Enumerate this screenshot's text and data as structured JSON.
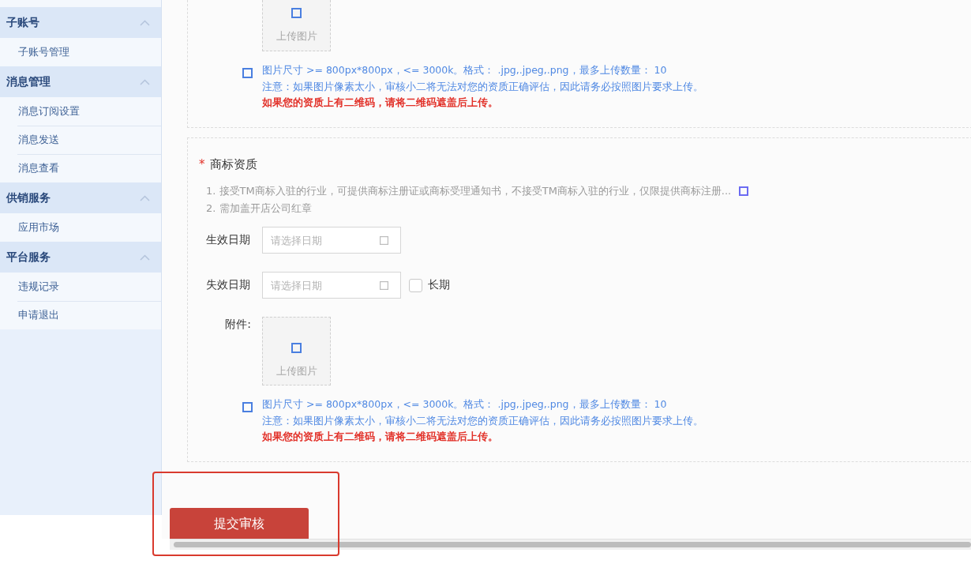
{
  "sidebar": {
    "groups": [
      {
        "title": "子账号",
        "expanded": true,
        "items": [
          {
            "label": "子账号管理",
            "selected": false
          }
        ]
      },
      {
        "title": "消息管理",
        "expanded": true,
        "items": [
          {
            "label": "消息订阅设置",
            "selected": false
          },
          {
            "label": "消息发送",
            "selected": false
          },
          {
            "label": "消息查看",
            "selected": false
          }
        ]
      },
      {
        "title": "供销服务",
        "expanded": true,
        "items": [
          {
            "label": "应用市场",
            "selected": false
          }
        ]
      },
      {
        "title": "平台服务",
        "expanded": true,
        "items": [
          {
            "label": "违规记录",
            "selected": false
          },
          {
            "label": "申请退出",
            "selected": false
          }
        ]
      }
    ]
  },
  "upload_section": {
    "upload": {
      "label": "上传图片"
    },
    "hint": {
      "rule": "图片尺寸 >= 800px*800px，<= 3000k。格式： .jpg,.jpeg,.png，最多上传数量： 10",
      "notice": "注意：如果图片像素太小，审核小二将无法对您的资质正确评估，因此请务必按照图片要求上传。",
      "warning": "如果您的资质上有二维码，请将二维码遮盖后上传。"
    }
  },
  "trademark_section": {
    "required_mark": "*",
    "title": "商标资质",
    "notes": [
      {
        "text": "1. 接受TM商标入驻的行业，可提供商标注册证或商标受理通知书，不接受TM商标入驻的行业，仅限提供商标注册...",
        "expandable": true
      },
      {
        "text": "2. 需加盖开店公司红章",
        "expandable": false
      }
    ],
    "date_fields": [
      {
        "label": "生效日期",
        "placeholder": "请选择日期"
      },
      {
        "label": "失效日期",
        "placeholder": "请选择日期",
        "option": {
          "label": "长期",
          "checked": false
        }
      }
    ],
    "attachment": {
      "label": "附件:",
      "upload": {
        "label": "上传图片"
      },
      "hint": {
        "rule": "图片尺寸 >= 800px*800px，<= 3000k。格式： .jpg,.jpeg,.png，最多上传数量： 10",
        "notice": "注意：如果图片像素太小，审核小二将无法对您的资质正确评估，因此请务必按照图片要求上传。",
        "warning": "如果您的资质上有二维码，请将二维码遮盖后上传。"
      }
    }
  },
  "submit_button": {
    "label": "提交审核"
  }
}
